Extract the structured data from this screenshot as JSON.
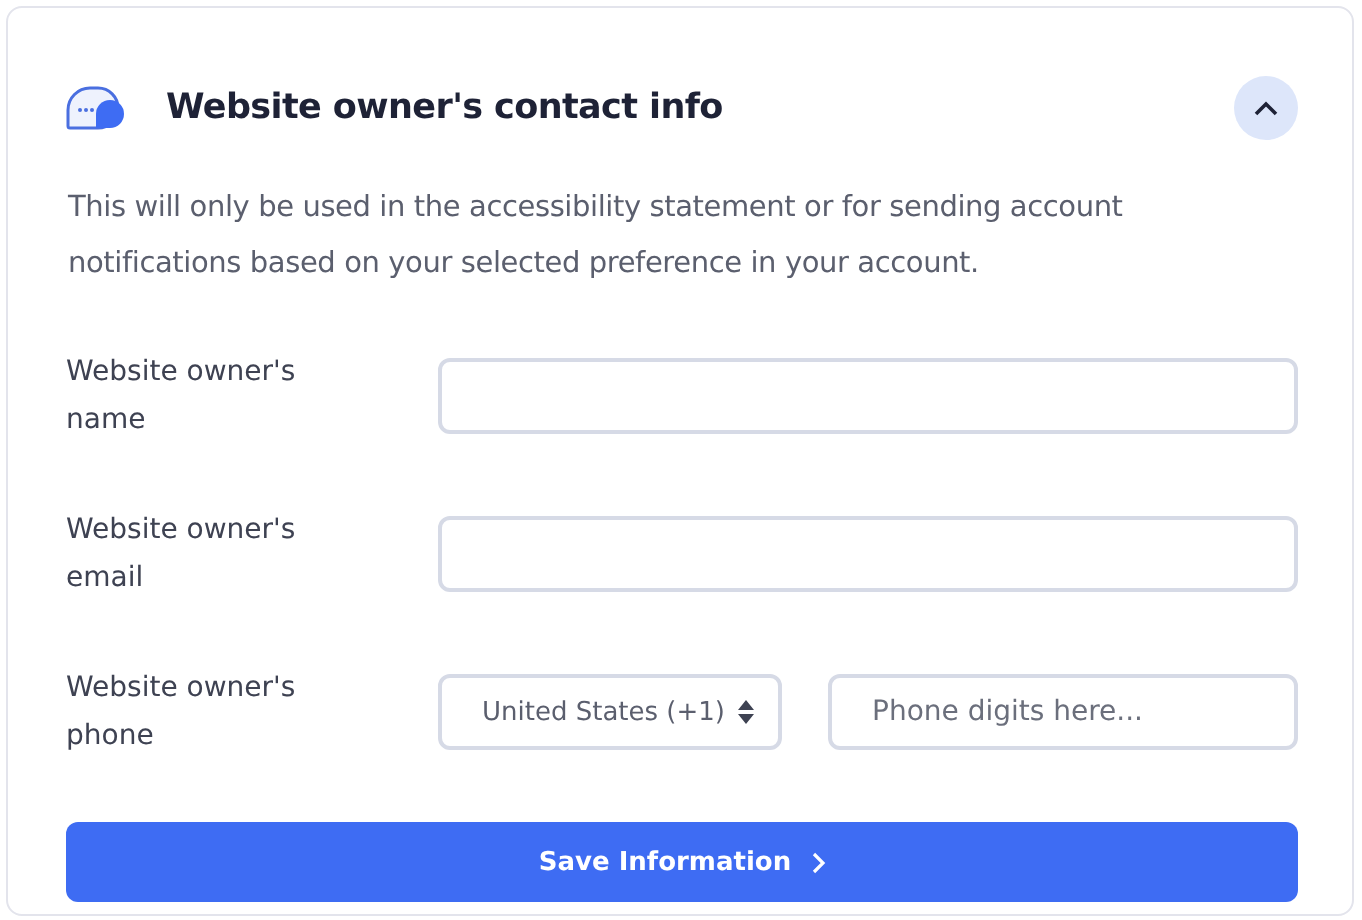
{
  "panel": {
    "title": "Website owner's contact info",
    "expanded": true,
    "description": "This will only be used in the accessibility statement or for sending account notifications based on your selected preference in your account."
  },
  "fields": [
    {
      "kind": "text",
      "label": "Website owner's name"
    },
    {
      "kind": "text",
      "label": "Website owner's email"
    },
    {
      "kind": "phone",
      "label": "Website owner's phone",
      "country": "United States (+1)",
      "placeholder": "Phone digits here..."
    }
  ],
  "button": {
    "label": "Save Information"
  }
}
